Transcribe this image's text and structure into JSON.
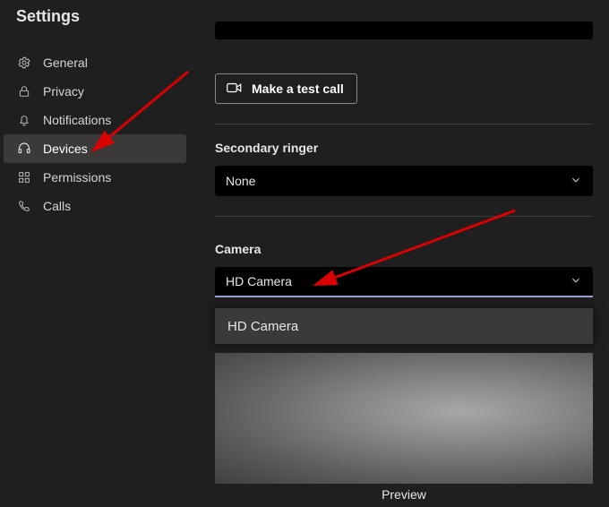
{
  "header": {
    "title": "Settings"
  },
  "sidebar": {
    "items": [
      {
        "label": "General"
      },
      {
        "label": "Privacy"
      },
      {
        "label": "Notifications"
      },
      {
        "label": "Devices"
      },
      {
        "label": "Permissions"
      },
      {
        "label": "Calls"
      }
    ],
    "active_index": 3
  },
  "main": {
    "test_call_label": "Make a test call",
    "secondary_ringer": {
      "label": "Secondary ringer",
      "value": "None"
    },
    "camera": {
      "label": "Camera",
      "value": "HD Camera",
      "options": [
        "HD Camera"
      ],
      "preview_label": "Preview"
    }
  },
  "colors": {
    "accent": "#9b9dd6"
  },
  "annotations": [
    "arrow-to-devices",
    "arrow-to-camera-dropdown"
  ]
}
